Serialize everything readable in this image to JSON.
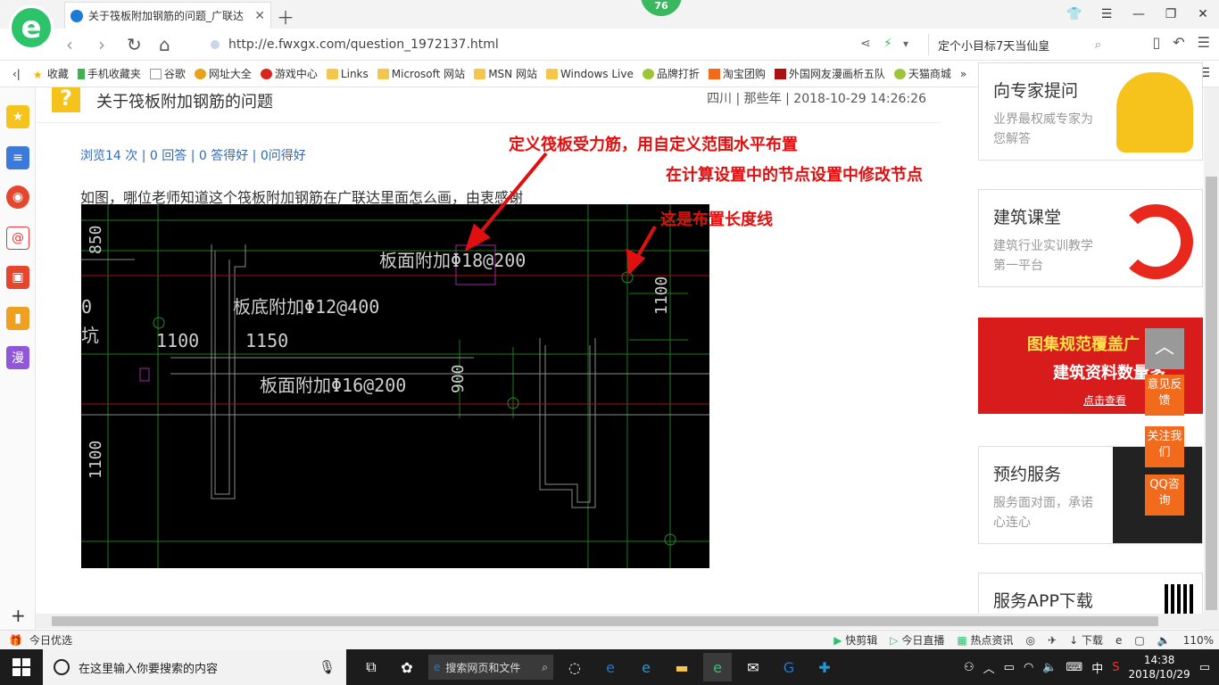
{
  "browser": {
    "badge": "76",
    "tab_title": "关于筏板附加钢筋的问题_广联达",
    "url": "http://e.fwxgx.com/question_1972137.html",
    "search_text": "定个小目标7天当仙皇"
  },
  "bookmarks": [
    "收藏",
    "手机收藏夹",
    "谷歌",
    "网址大全",
    "游戏中心",
    "Links",
    "Microsoft 网站",
    "MSN 网站",
    "Windows Live",
    "品牌打折",
    "淘宝团购",
    "外国网友漫画析五队",
    "天猫商城"
  ],
  "question": {
    "title": "关于筏板附加钢筋的问题",
    "meta": "四川 | 那些年 | 2018-10-29 14:26:26",
    "stats": "浏览14 次 | 0 回答 | 0 答得好 | 0问得好",
    "body": "如图，哪位老师知道这个筏板附加钢筋在广联达里面怎么画，由衷感谢"
  },
  "annotations": {
    "a1": "定义筏板受力筋，用自定义范围水平布置",
    "a2": "在计算设置中的节点设置中修改节点",
    "a3": "这是布置长度线"
  },
  "cad_labels": {
    "top_rebar": "板面附加Φ18@200",
    "bottom_rebar": "板底附加Φ12@400",
    "mid_rebar": "板面附加Φ16@200",
    "dim_1100a": "1100",
    "dim_1150": "1150",
    "dim_900": "900",
    "dim_1100b": "1100",
    "dim_1100c": "1100",
    "dim_850": "850",
    "dim_0": "0",
    "char_keng": "坑"
  },
  "right": {
    "card1_title": "向专家提问",
    "card1_desc": "业界最权威专家为您解答",
    "card2_title": "建筑课堂",
    "card2_desc": "建筑行业实训教学第一平台",
    "banner_l1": "图集规范覆盖广",
    "banner_l2": "建筑资料数量多",
    "banner_l3": "点击查看",
    "card3_title": "预约服务",
    "card3_desc": "服务面对面，承诺心连心",
    "card4_title": "服务APP下载",
    "float1": "意见反馈",
    "float2": "关注我们",
    "float3": "QQ咨询"
  },
  "statusbar": {
    "left": "今日优选",
    "items": [
      "快剪辑",
      "今日直播",
      "热点资讯",
      "下载"
    ],
    "zoom": "110%"
  },
  "taskbar": {
    "search_placeholder": "在这里输入你要搜索的内容",
    "web_search": "搜索网页和文件",
    "ime": "中",
    "time": "14:38",
    "date": "2018/10/29"
  }
}
